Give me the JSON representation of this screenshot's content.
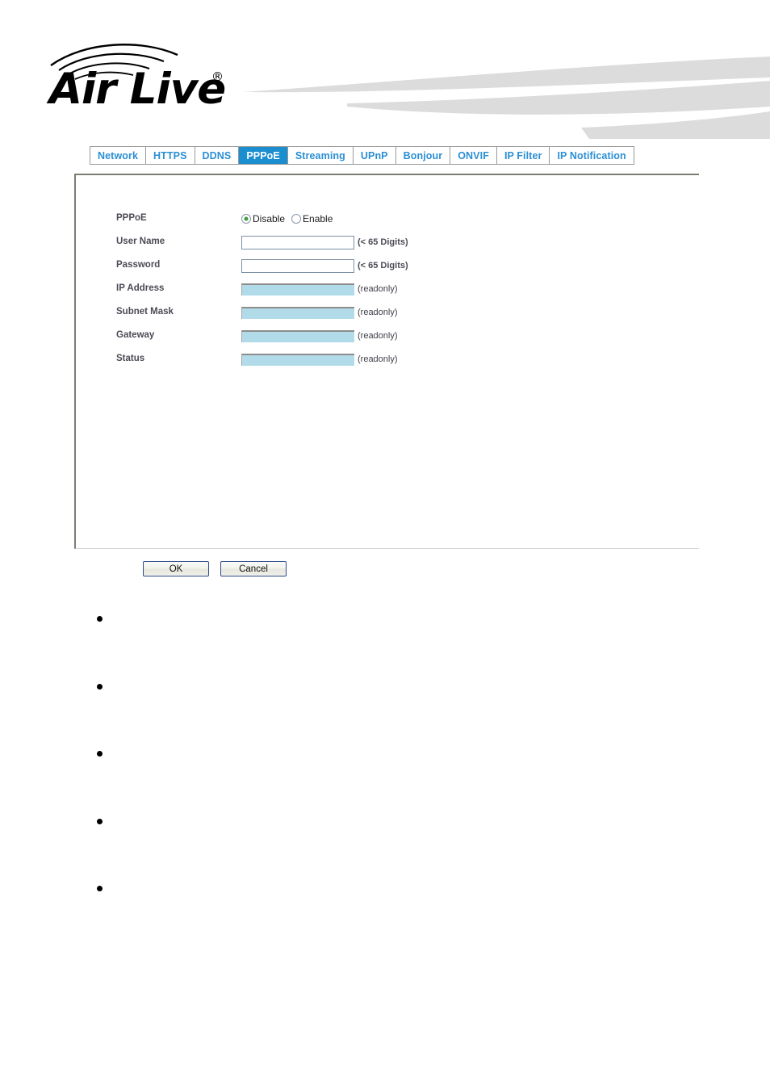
{
  "brand": {
    "name": "Air Live",
    "registered_mark": "®"
  },
  "tabs": [
    {
      "label": "Network",
      "active": false
    },
    {
      "label": "HTTPS",
      "active": false
    },
    {
      "label": "DDNS",
      "active": false
    },
    {
      "label": "PPPoE",
      "active": true
    },
    {
      "label": "Streaming",
      "active": false
    },
    {
      "label": "UPnP",
      "active": false
    },
    {
      "label": "Bonjour",
      "active": false
    },
    {
      "label": "ONVIF",
      "active": false
    },
    {
      "label": "IP Filter",
      "active": false
    },
    {
      "label": "IP Notification",
      "active": false
    }
  ],
  "form": {
    "pppoe": {
      "label": "PPPoE",
      "options": [
        {
          "label": "Disable",
          "selected": true
        },
        {
          "label": "Enable",
          "selected": false
        }
      ]
    },
    "user_name": {
      "label": "User Name",
      "value": "",
      "placeholder": "",
      "hint": "(< 65 Digits)"
    },
    "password": {
      "label": "Password",
      "value": "",
      "placeholder": "",
      "hint": "(< 65 Digits)"
    },
    "ip_address": {
      "label": "IP Address",
      "value": "",
      "hint": "(readonly)"
    },
    "subnet_mask": {
      "label": "Subnet Mask",
      "value": "",
      "hint": "(readonly)"
    },
    "gateway": {
      "label": "Gateway",
      "value": "",
      "hint": "(readonly)"
    },
    "status": {
      "label": "Status",
      "value": "",
      "hint": "(readonly)"
    }
  },
  "buttons": {
    "ok": "OK",
    "cancel": "Cancel"
  },
  "bullets": [
    {
      "text": ""
    },
    {
      "text": ""
    },
    {
      "text": ""
    },
    {
      "text": ""
    },
    {
      "text": ""
    }
  ],
  "colors": {
    "tab_text": "#2b8fd4",
    "tab_active_bg": "#1b8ed0",
    "tab_active_text": "#ffffff",
    "label_text": "#4b4b56",
    "readonly_field_bg": "#b1dbe9",
    "swoosh_gray": "#dcdcdc",
    "button_border": "#2b4a8b",
    "radio_selected_dot": "#3c9c3c"
  }
}
